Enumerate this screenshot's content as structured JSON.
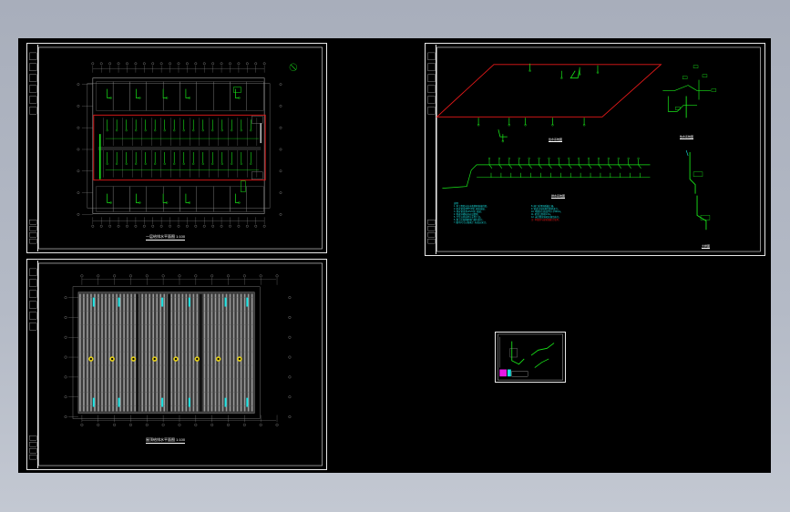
{
  "app": {
    "window_title": "",
    "background": "#b4bac6",
    "canvas_color": "#000000"
  },
  "colors": {
    "frame": "#e8e8e8",
    "wall": "#8c8c8c",
    "pipe_green": "#19e619",
    "pipe_red": "#e61919",
    "note_cyan": "#19e6e6",
    "highlight_yellow": "#e6d119",
    "magenta": "#e619e6"
  },
  "sheets": [
    {
      "id": "plan-upper",
      "caption": "一层给排水平面图 1:100"
    },
    {
      "id": "plan-lower",
      "caption": "屋顶给排水平面图 1:100"
    },
    {
      "id": "system-diagrams",
      "captions": [
        "给水系统图",
        "排水系统图",
        "热水系统图",
        "大样图"
      ]
    },
    {
      "id": "detail-thumb",
      "caption": ""
    }
  ],
  "notes": {
    "heading": "说明:",
    "col1": [
      "1. 本工程给水由市政管网直接供给。",
      "2. 给水管采用PP-R管, 热熔连接。",
      "3. 排水管采用UPVC管, 粘接。",
      "4. 管道穿楼板处应设套管。",
      "5. 卫生洁具选用节水型产品。",
      "6. 施工应按国家现行规范执行。",
      "7. 图中尺寸以毫米计, 标高以米计。"
    ],
    "col2": [
      "8. 阀门采用铜质截止阀。",
      "9. 管道试压按规范要求进行。",
      "10. 地漏水封高度不小于50mm。",
      "11. 检查口距地1.0m。",
      "12. 未尽事宜按相关规范执行。"
    ],
    "col2_red": "注: 本图须与建筑图配合使用。"
  },
  "markers": {
    "north": "N",
    "yellow_count": 8
  }
}
